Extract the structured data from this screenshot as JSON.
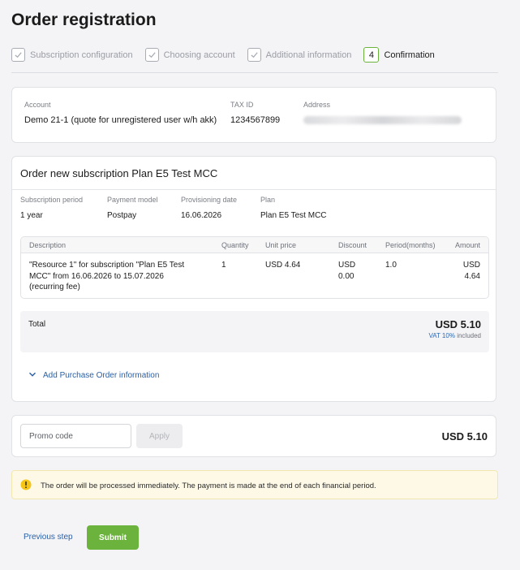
{
  "page": {
    "title": "Order registration"
  },
  "steps": [
    {
      "label": "Subscription configuration"
    },
    {
      "label": "Choosing account"
    },
    {
      "label": "Additional information"
    },
    {
      "label": "Confirmation",
      "number": "4"
    }
  ],
  "account": {
    "account_label": "Account",
    "account_value": "Demo 21-1 (quote for unregistered user w/h akk)",
    "tax_label": "TAX ID",
    "tax_value": "1234567899",
    "address_label": "Address"
  },
  "order": {
    "title": "Order new subscription Plan E5 Test MCC",
    "meta": [
      {
        "label": "Subscription period",
        "value": "1 year"
      },
      {
        "label": "Payment model",
        "value": "Postpay"
      },
      {
        "label": "Provisioning date",
        "value": "16.06.2026"
      },
      {
        "label": "Plan",
        "value": "Plan E5 Test MCC"
      }
    ],
    "table": {
      "headers": {
        "description": "Description",
        "quantity": "Quantity",
        "unit_price": "Unit price",
        "discount": "Discount",
        "period": "Period(months)",
        "amount": "Amount"
      },
      "row": {
        "description_line1": "\"Resource 1\" for subscription \"Plan E5 Test",
        "description_line2": "MCC\" from 16.06.2026 to 15.07.2026",
        "description_line3": "(recurring fee)",
        "quantity": "1",
        "unit_price": "USD 4.64",
        "discount_line1": "USD",
        "discount_line2": "0.00",
        "period": "1.0",
        "amount_line1": "USD",
        "amount_line2": "4.64"
      }
    },
    "total_label": "Total",
    "total_amount": "USD 5.10",
    "vat_link": "VAT 10%",
    "vat_suffix": "included",
    "po_link": "Add Purchase Order information"
  },
  "promo": {
    "placeholder": "Promo code",
    "apply_label": "Apply",
    "total": "USD 5.10"
  },
  "notice": {
    "text": "The order will be processed immediately. The payment is made at the end of each financial period."
  },
  "footer": {
    "prev_label": "Previous step",
    "submit_label": "Submit"
  },
  "colors": {
    "accent_green": "#6cb33e",
    "link_blue": "#2b5fa4",
    "notice_bg": "#fdf9e6",
    "warning_yellow": "#f5c518"
  }
}
